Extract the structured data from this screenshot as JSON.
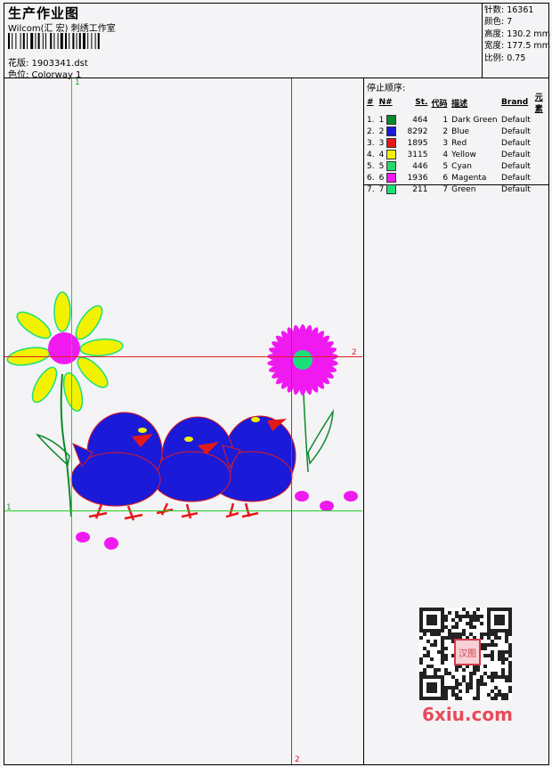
{
  "header": {
    "title": "生产作业图",
    "subtitle": "Wilcom(汇 宏) 刺绣工作室",
    "design_label": "花版: 1903341.dst",
    "colorway_label": "色位: Colorway 1"
  },
  "stats": {
    "stitches": "针数: 16361",
    "colors": "颜色: 7",
    "height": "高度: 130.2 mm",
    "width": "宽度: 177.5 mm",
    "scale": "比例: 0.75"
  },
  "stop_sequence": {
    "title": "停止顺序:",
    "columns": [
      "#",
      "N#",
      "St.",
      "代码",
      "描述",
      "Brand",
      "元素"
    ],
    "rows": [
      {
        "idx": "1.",
        "n": "1",
        "color": "#0a8a2a",
        "st": "464",
        "code": "1",
        "desc": "Dark Green",
        "brand": "Default"
      },
      {
        "idx": "2.",
        "n": "2",
        "color": "#1a1ad8",
        "st": "8292",
        "code": "2",
        "desc": "Blue",
        "brand": "Default"
      },
      {
        "idx": "3.",
        "n": "3",
        "color": "#e41a1a",
        "st": "1895",
        "code": "3",
        "desc": "Red",
        "brand": "Default"
      },
      {
        "idx": "4.",
        "n": "4",
        "color": "#f2f200",
        "st": "3115",
        "code": "4",
        "desc": "Yellow",
        "brand": "Default"
      },
      {
        "idx": "5.",
        "n": "5",
        "color": "#2ad86a",
        "st": "446",
        "code": "5",
        "desc": "Cyan",
        "brand": "Default"
      },
      {
        "idx": "6.",
        "n": "6",
        "color": "#f01af0",
        "st": "1936",
        "code": "6",
        "desc": "Magenta",
        "brand": "Default"
      },
      {
        "idx": "7.",
        "n": "7",
        "color": "#1ae07a",
        "st": "211",
        "code": "7",
        "desc": "Green",
        "brand": "Default"
      }
    ]
  },
  "guides": {
    "green_label": "1",
    "red_label": "2",
    "green_color": "#22d022",
    "red_color": "#e02020"
  },
  "watermark": {
    "text": "6xiu.com",
    "stamp_text": "汉图"
  }
}
